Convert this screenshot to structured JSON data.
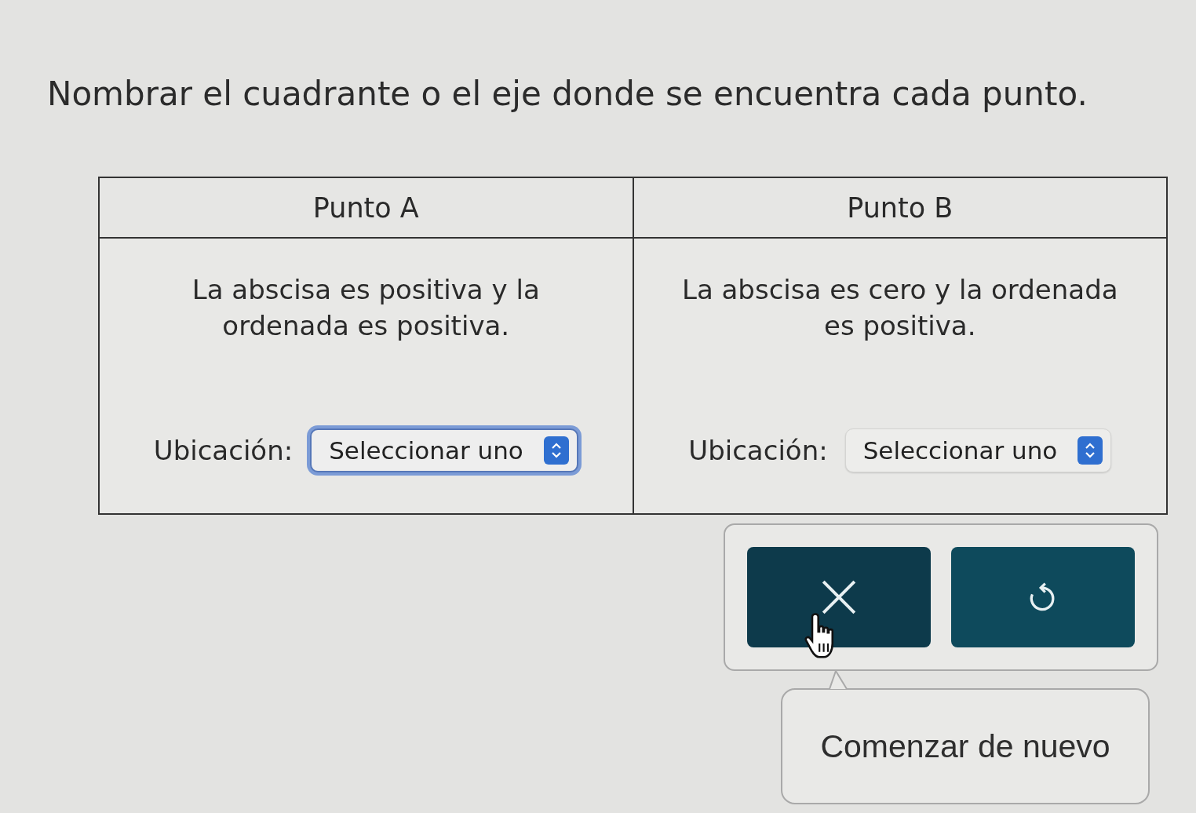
{
  "instruction": "Nombrar el cuadrante o el eje donde se encuentra cada punto.",
  "table": {
    "columns": [
      {
        "heading": "Punto A",
        "description": "La abscisa es positiva y la ordenada es positiva.",
        "location_label": "Ubicación:",
        "select": {
          "value": "Seleccionar uno",
          "focused": true
        }
      },
      {
        "heading": "Punto B",
        "description": "La abscisa es cero y la ordenada es positiva.",
        "location_label": "Ubicación:",
        "select": {
          "value": "Seleccionar uno",
          "focused": false
        }
      }
    ]
  },
  "actions": {
    "buttons": [
      {
        "kind": "clear",
        "hovered": true
      },
      {
        "kind": "reset",
        "hovered": false
      }
    ]
  },
  "tooltip": {
    "text": "Comenzar de nuevo"
  },
  "cursor": {
    "kind": "hand"
  }
}
